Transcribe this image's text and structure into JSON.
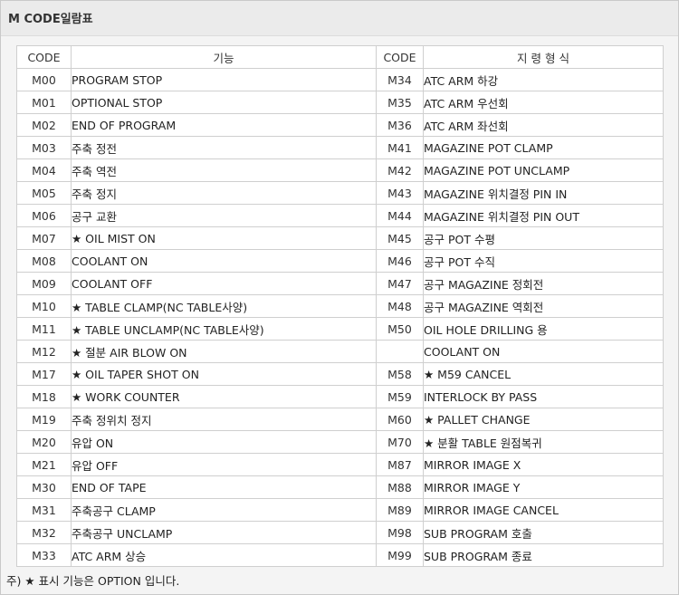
{
  "title": "M CODE일람표",
  "table": {
    "headers": [
      "CODE",
      "기능",
      "CODE",
      "지 령 형 식"
    ],
    "rows": [
      [
        "M00",
        "PROGRAM STOP",
        "M34",
        "ATC ARM 하강"
      ],
      [
        "M01",
        "OPTIONAL STOP",
        "M35",
        "ATC ARM 우선회"
      ],
      [
        "M02",
        "END OF PROGRAM",
        "M36",
        "ATC ARM 좌선회"
      ],
      [
        "M03",
        "주축 정전",
        "M41",
        "MAGAZINE POT CLAMP"
      ],
      [
        "M04",
        "주축 역전",
        "M42",
        "MAGAZINE POT UNCLAMP"
      ],
      [
        "M05",
        "주축 정지",
        "M43",
        "MAGAZINE 위치결정 PIN IN"
      ],
      [
        "M06",
        "공구 교환",
        "M44",
        "MAGAZINE 위치결정 PIN OUT"
      ],
      [
        "M07",
        "★ OIL MIST ON",
        "M45",
        "공구 POT 수평"
      ],
      [
        "M08",
        "COOLANT ON",
        "M46",
        "공구 POT 수직"
      ],
      [
        "M09",
        "COOLANT OFF",
        "M47",
        "공구 MAGAZINE 정회전"
      ],
      [
        "M10",
        "★ TABLE CLAMP(NC TABLE사양)",
        "M48",
        "공구 MAGAZINE 역회전"
      ],
      [
        "M11",
        "★ TABLE UNCLAMP(NC TABLE사양)",
        "M50",
        "OIL HOLE DRILLING 용"
      ],
      [
        "M12",
        "★ 절분 AIR BLOW ON",
        "",
        "COOLANT ON"
      ],
      [
        "M17",
        "★ OIL TAPER SHOT ON",
        "M58",
        "★ M59 CANCEL"
      ],
      [
        "M18",
        "★ WORK COUNTER",
        "M59",
        "INTERLOCK BY PASS"
      ],
      [
        "M19",
        "주축 정위치 정지",
        "M60",
        "★ PALLET CHANGE"
      ],
      [
        "M20",
        "유압 ON",
        "M70",
        "★ 분활 TABLE 원점복귀"
      ],
      [
        "M21",
        "유압 OFF",
        "M87",
        "MIRROR IMAGE X"
      ],
      [
        "M30",
        "END OF TAPE",
        "M88",
        "MIRROR IMAGE Y"
      ],
      [
        "M31",
        "주축공구 CLAMP",
        "M89",
        "MIRROR IMAGE CANCEL"
      ],
      [
        "M32",
        "주축공구 UNCLAMP",
        "M98",
        "SUB PROGRAM 호출"
      ],
      [
        "M33",
        "ATC ARM 상승",
        "M99",
        "SUB PROGRAM 종료"
      ]
    ]
  },
  "footnote": "주) ★ 표시 기능은 OPTION 입니다."
}
